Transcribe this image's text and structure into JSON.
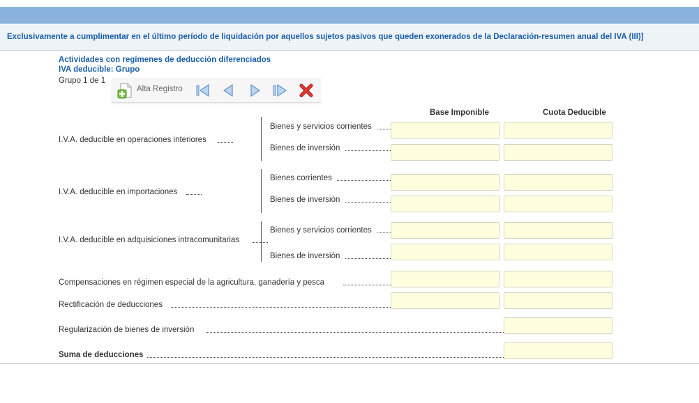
{
  "banner": {
    "text": "Exclusivamente a cumplimentar en el último período de liquidación por aquellos sujetos pasivos que queden exonerados de la Declaración-resumen anual del IVA (III)]"
  },
  "section": {
    "title": "Actividades con regímenes de deducción diferenciados",
    "subtitle": "IVA deducible: Grupo",
    "group_counter": "Grupo 1 de 1"
  },
  "toolbar": {
    "add_label": "Alta Registro",
    "icons": [
      "add-record-icon",
      "first-record-icon",
      "previous-record-icon",
      "next-record-icon",
      "last-record-icon",
      "delete-record-icon"
    ]
  },
  "columns": {
    "base": "Base Imponible",
    "cuota": "Cuota Deducible"
  },
  "rows": {
    "interiores": {
      "label": "I.V.A. deducible en operaciones interiores",
      "sub1": "Bienes y servicios corrientes",
      "sub2": "Bienes de inversión",
      "sub1_base": "",
      "sub1_cuota": "",
      "sub2_base": "",
      "sub2_cuota": ""
    },
    "importaciones": {
      "label": "I.V.A. deducible en importaciones",
      "sub1": "Bienes corrientes",
      "sub2": "Bienes de inversión",
      "sub1_base": "",
      "sub1_cuota": "",
      "sub2_base": "",
      "sub2_cuota": ""
    },
    "intracomunitarias": {
      "label": "I.V.A. deducible en adquisiciones intracomunitarias",
      "sub1": "Bienes y servicios corrientes",
      "sub2": "Bienes de inversión",
      "sub1_base": "",
      "sub1_cuota": "",
      "sub2_base": "",
      "sub2_cuota": ""
    },
    "compensaciones": {
      "label": "Compensaciones en régimen especial de la agricultura, ganadería y pesca",
      "base": "",
      "cuota": ""
    },
    "rectificacion": {
      "label": "Rectificación de deducciones",
      "base": "",
      "cuota": ""
    },
    "regularizacion": {
      "label": "Regularización de bienes de inversión",
      "cuota": ""
    },
    "suma": {
      "label": "Suma de deducciones",
      "cuota": ""
    }
  },
  "colors": {
    "top_bar": "#89b3dc",
    "banner_bg": "#eef3f8",
    "heading_blue": "#1a5faa",
    "field_bg": "#ffffe0"
  }
}
